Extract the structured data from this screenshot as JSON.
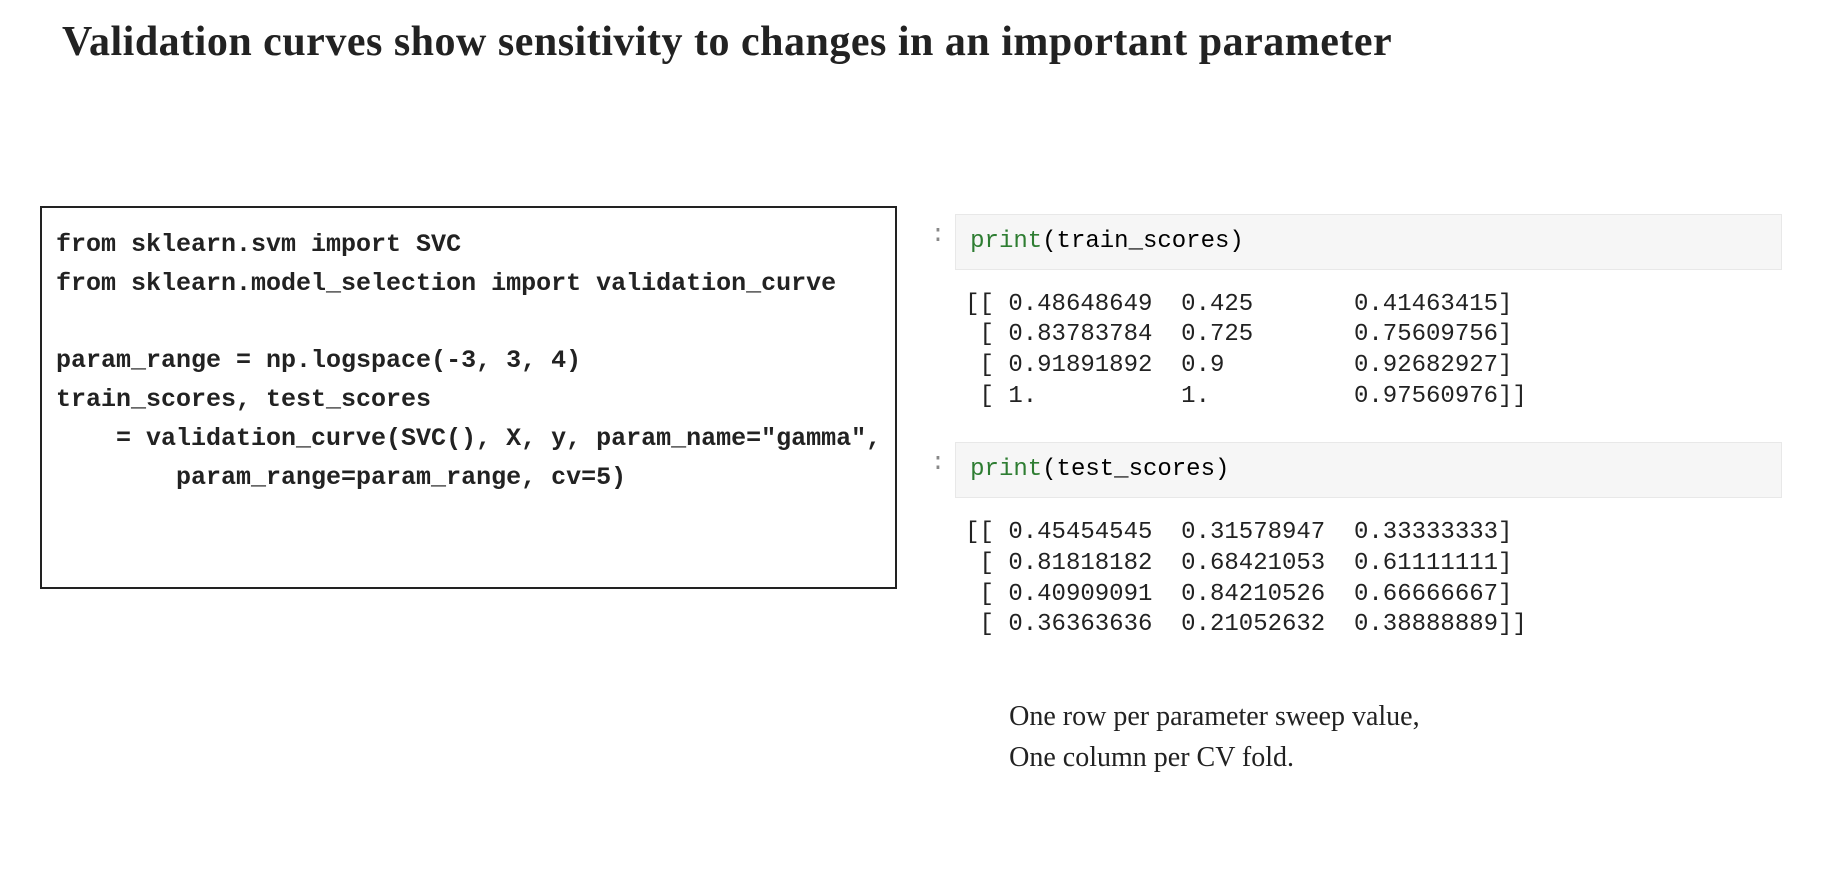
{
  "title": "Validation curves show sensitivity to changes in an important parameter",
  "code_left": "from sklearn.svm import SVC\nfrom sklearn.model_selection import validation_curve\n\nparam_range = np.logspace(-3, 3, 4)\ntrain_scores, test_scores\n    = validation_curve(SVC(), X, y, param_name=\"gamma\",\n        param_range=param_range, cv=5)",
  "cell1": {
    "prompt": ":",
    "print_kw": "print",
    "print_arg": "(train_scores)"
  },
  "output1": "[[ 0.48648649  0.425       0.41463415]\n [ 0.83783784  0.725       0.75609756]\n [ 0.91891892  0.9         0.92682927]\n [ 1.          1.          0.97560976]]",
  "cell2": {
    "prompt": ":",
    "print_kw": "print",
    "print_arg": "(test_scores)"
  },
  "output2": "[[ 0.45454545  0.31578947  0.33333333]\n [ 0.81818182  0.68421053  0.61111111]\n [ 0.40909091  0.84210526  0.66666667]\n [ 0.36363636  0.21052632  0.38888889]]",
  "caption_line1": "One row per parameter sweep value,",
  "caption_line2": "One column per CV fold."
}
